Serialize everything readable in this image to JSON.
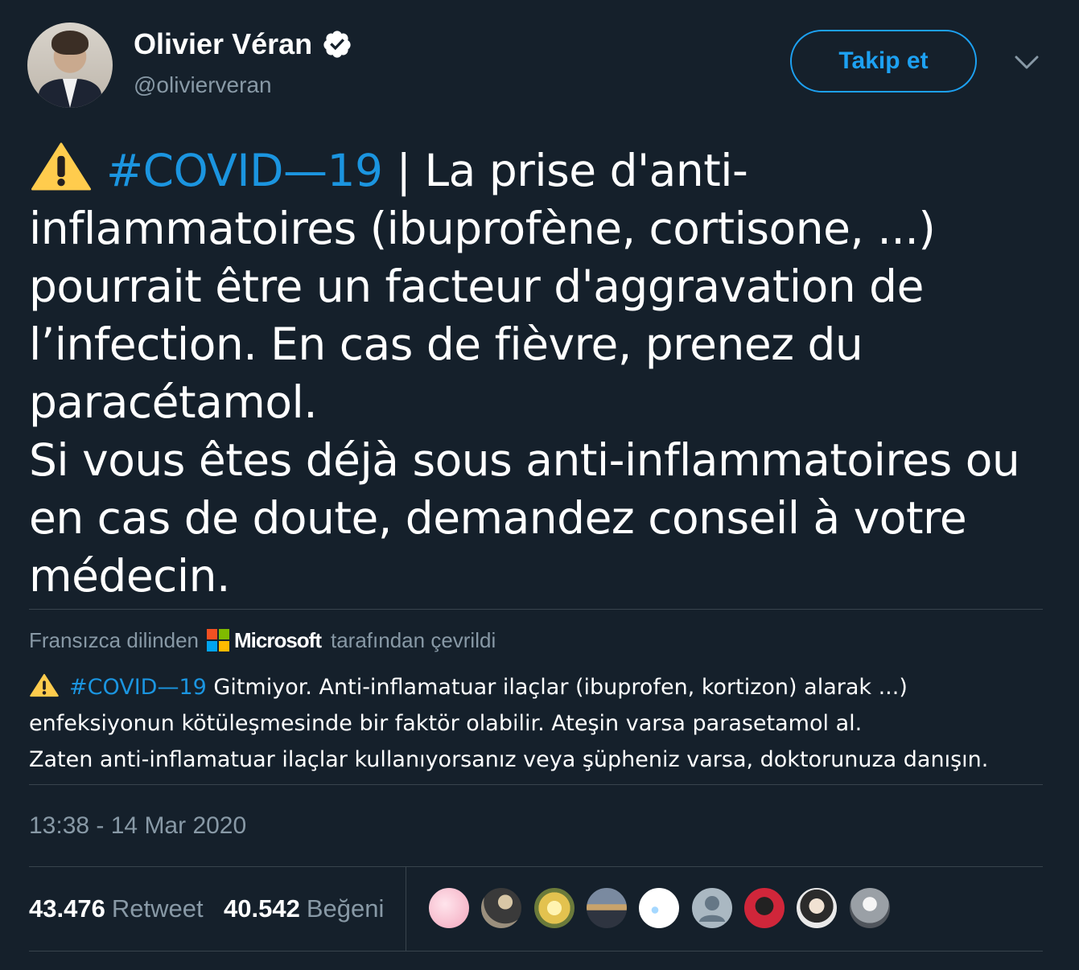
{
  "author": {
    "display_name": "Olivier Véran",
    "handle": "@olivierveran",
    "verified": true
  },
  "actions": {
    "follow_label": "Takip et",
    "more_icon": "chevron-down-icon"
  },
  "tweet": {
    "warning_icon": "warning-icon",
    "hashtag": "#COVID—19",
    "lines": [
      " | La prise d'anti-",
      "inflammatoires (ibuprofène, cortisone, ...)",
      "pourrait être un facteur d'aggravation de",
      "l’infection. En cas de fièvre, prenez du",
      "paracétamol.",
      "Si vous êtes déjà sous anti-inflammatoires ou",
      "en cas de doute, demandez conseil à votre",
      "médecin."
    ]
  },
  "translation": {
    "prefix": "Fransızca dilinden",
    "provider": "Microsoft",
    "suffix": "tarafından çevrildi",
    "hashtag": "#COVID—19",
    "lines": [
      " Gitmiyor. Anti-inflamatuar ilaçlar (ibuprofen, kortizon) alarak ...)",
      "enfeksiyonun kötüleşmesinde bir faktör olabilir. Ateşin varsa parasetamol al.",
      "Zaten anti-inflamatuar ilaçlar kullanıyorsanız veya şüpheniz varsa, doktorunuza danışın."
    ]
  },
  "timestamp": "13:38 - 14 Mar 2020",
  "stats": {
    "retweets_count": "43.476",
    "retweets_label": "Retweet",
    "likes_count": "40.542",
    "likes_label": "Beğeni"
  },
  "colors": {
    "background": "#15202b",
    "accent": "#1da1f2",
    "hashtag": "#1b95e0",
    "muted": "#8899a6",
    "divider": "#38444d"
  }
}
